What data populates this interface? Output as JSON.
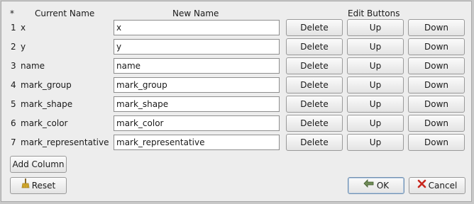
{
  "headers": {
    "index": "*",
    "current_name": "Current Name",
    "new_name": "New Name",
    "edit_buttons": "Edit Buttons"
  },
  "rows": [
    {
      "num": "1",
      "current": "x",
      "new": "x",
      "delete": "Delete",
      "up": "Up",
      "down": "Down"
    },
    {
      "num": "2",
      "current": "y",
      "new": "y",
      "delete": "Delete",
      "up": "Up",
      "down": "Down"
    },
    {
      "num": "3",
      "current": "name",
      "new": "name",
      "delete": "Delete",
      "up": "Up",
      "down": "Down"
    },
    {
      "num": "4",
      "current": "mark_group",
      "new": "mark_group",
      "delete": "Delete",
      "up": "Up",
      "down": "Down"
    },
    {
      "num": "5",
      "current": "mark_shape",
      "new": "mark_shape",
      "delete": "Delete",
      "up": "Up",
      "down": "Down"
    },
    {
      "num": "6",
      "current": "mark_color",
      "new": "mark_color",
      "delete": "Delete",
      "up": "Up",
      "down": "Down"
    },
    {
      "num": "7",
      "current": "mark_representative",
      "new": "mark_representative",
      "delete": "Delete",
      "up": "Up",
      "down": "Down"
    }
  ],
  "buttons": {
    "add_column": "Add Column",
    "reset": "Reset",
    "ok": "OK",
    "cancel": "Cancel"
  },
  "icons": {
    "reset": "broom-icon",
    "ok": "check-arrow-icon",
    "cancel": "x-icon"
  }
}
